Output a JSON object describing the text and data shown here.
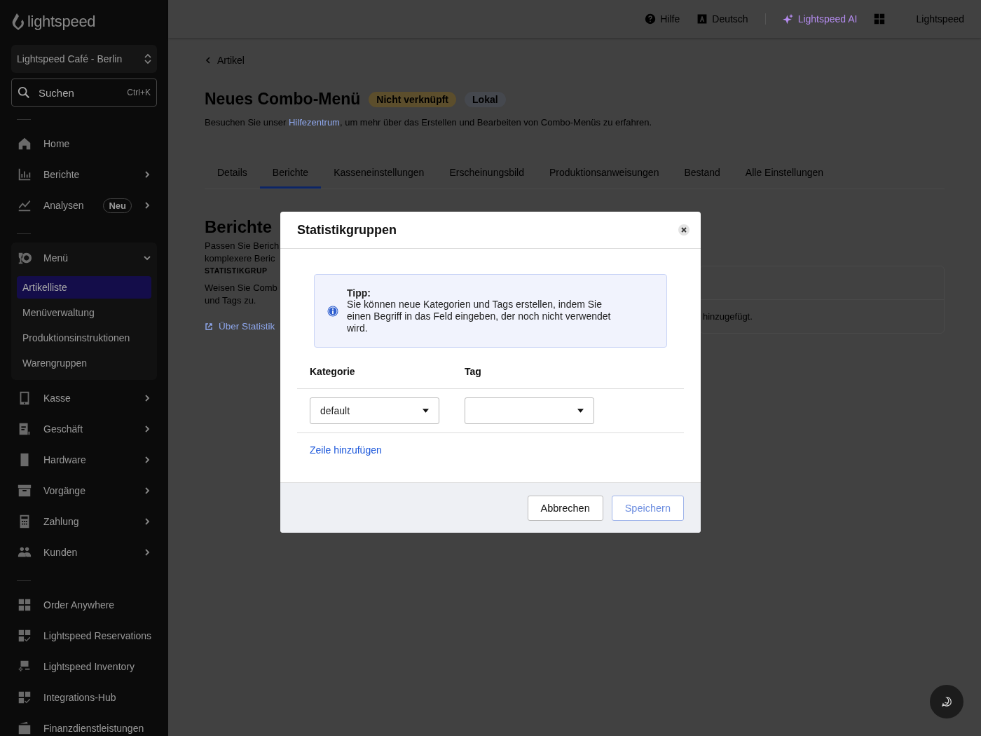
{
  "sidebar": {
    "logo": "lightspeed",
    "location": "Lightspeed Café - Berlin",
    "search": {
      "placeholder": "Suchen",
      "shortcut": "Ctrl+K"
    },
    "groups": [
      [
        {
          "label": "Home",
          "chevron": false
        },
        {
          "label": "Berichte",
          "chevron": true
        },
        {
          "label": "Analysen",
          "chevron": true,
          "badge": "Neu"
        }
      ],
      [
        {
          "label": "Menü",
          "expanded": true,
          "children": [
            {
              "label": "Artikelliste",
              "selected": true
            },
            {
              "label": "Menüverwaltung",
              "selected": false
            },
            {
              "label": "Produktionsinstruktionen",
              "selected": false
            },
            {
              "label": "Warengruppen",
              "selected": false
            }
          ]
        },
        {
          "label": "Kasse",
          "chevron": true
        },
        {
          "label": "Geschäft",
          "chevron": true
        },
        {
          "label": "Hardware",
          "chevron": true
        },
        {
          "label": "Vorgänge",
          "chevron": true
        },
        {
          "label": "Zahlung",
          "chevron": true
        },
        {
          "label": "Kunden",
          "chevron": true
        }
      ],
      [
        {
          "label": "Order Anywhere"
        },
        {
          "label": "Lightspeed Reservations"
        },
        {
          "label": "Lightspeed Inventory"
        },
        {
          "label": "Integrations-Hub"
        },
        {
          "label": "Finanzdienstleistungen"
        }
      ]
    ]
  },
  "topbar": {
    "items": [
      {
        "label": "Hilfe",
        "kind": "help"
      },
      {
        "label": "Deutsch",
        "kind": "lang"
      },
      {
        "label": "Lightspeed AI",
        "kind": "ai"
      },
      {
        "kind": "apps"
      },
      {
        "label": "Lightspeed",
        "kind": "account"
      }
    ]
  },
  "page": {
    "back": "Artikel",
    "title": "Neues Combo-Menü",
    "badges": [
      {
        "label": "Nicht verknüpft",
        "color": "#5c4e2c"
      },
      {
        "label": "Lokal",
        "color": "#45484e"
      }
    ],
    "intro": {
      "before": "Besuchen Sie unser ",
      "link": "Hilfezentrum",
      "after": ", um mehr über das Erstellen und Bearbeiten von Combo-Menüs zu erfahren."
    },
    "tabs": [
      {
        "label": "Details",
        "selected": false
      },
      {
        "label": "Berichte",
        "selected": true
      },
      {
        "label": "Kasseneinstellungen",
        "selected": false
      },
      {
        "label": "Erscheinungsbild",
        "selected": false
      },
      {
        "label": "Produktionsanweisungen",
        "selected": false
      },
      {
        "label": "Bestand",
        "selected": false
      },
      {
        "label": "Alle Einstellungen",
        "selected": false
      }
    ],
    "section": {
      "title": "Berichte",
      "lines": [
        "Passen Sie Berich",
        "komplexere Beric"
      ],
      "caption": "STATISTIKGRUP",
      "assign": [
        "Weisen Sie Comb",
        "und Tags zu."
      ],
      "link": "Über Statistik"
    },
    "card": {
      "empty": "hinzugefügt."
    }
  },
  "dialog": {
    "title": "Statistikgruppen",
    "tip": {
      "title": "Tipp:",
      "text": "Sie können neue Kategorien und Tags erstellen, indem Sie einen Begriff in das Feld eingeben, der noch nicht verwendet wird."
    },
    "columns": [
      "Kategorie",
      "Tag"
    ],
    "rows": [
      {
        "category": "default"
      }
    ],
    "add_row": "Zeile hinzufügen",
    "buttons": [
      {
        "label": "Abbrechen",
        "kind": "secondary",
        "disabled": false
      },
      {
        "label": "Speichern",
        "kind": "primary",
        "disabled": true
      }
    ]
  }
}
